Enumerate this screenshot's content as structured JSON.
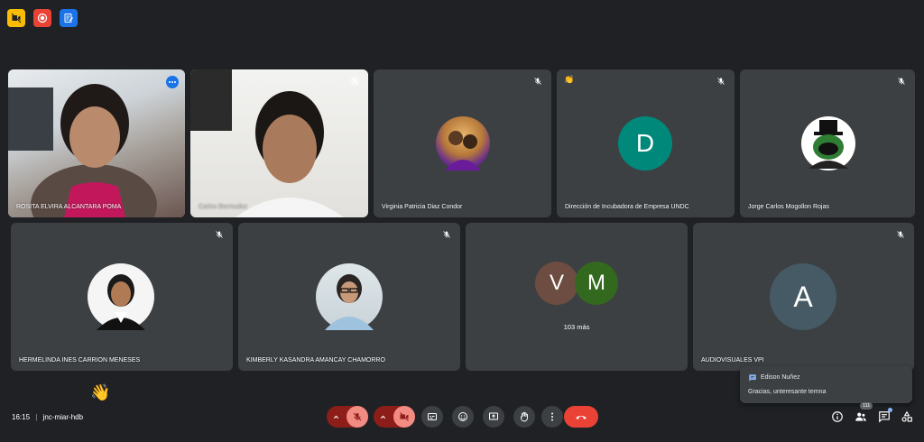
{
  "top_badges": [
    {
      "icon": "video-off-icon",
      "color": "#fbbc04"
    },
    {
      "icon": "record-icon",
      "color": "#ea4335"
    },
    {
      "icon": "notes-icon",
      "color": "#1a73e8"
    }
  ],
  "tiles": [
    {
      "name": "ROSITA ELVIRA ALCANTARA POMA",
      "type": "video"
    },
    {
      "name": "Carlos Bermudez",
      "type": "video"
    },
    {
      "name": "Virginia Patricia Diaz Condor",
      "type": "photo-avatar"
    },
    {
      "name": "Dirección de Incubadora de Empresa UNDC",
      "type": "letter",
      "letter": "D",
      "color": "#00897b",
      "reaction": "👏"
    },
    {
      "name": "Jorge Carlos Mogollon Rojas",
      "type": "photo-avatar"
    },
    {
      "name": "HERMELINDA INES CARRION MENESES",
      "type": "photo-avatar"
    },
    {
      "name": "KIMBERLY KASANDRA AMANCAY CHAMORRO",
      "type": "photo-avatar"
    },
    {
      "name": "",
      "type": "group",
      "letters": [
        "V",
        "M"
      ],
      "colors": [
        "#6d4c41",
        "#33691e"
      ],
      "more": "103 más"
    },
    {
      "name": "AUDIOVISUALES VPI",
      "type": "letter",
      "letter": "A",
      "color": "#455a64"
    }
  ],
  "floating_reaction": "👋",
  "chat_popup": {
    "sender": "Edison Nuñez",
    "message": "Gracias, unteresante temna"
  },
  "bottom": {
    "time": "16:15",
    "separator": "|",
    "meeting_code": "jnc-miar-hdb",
    "participants_count": "111"
  },
  "colors": {
    "background": "#202124",
    "tile": "#3c4043",
    "danger": "#ea4335",
    "muted_ctrl": "#8c1d18",
    "active_outline": "#8ab4f8"
  }
}
